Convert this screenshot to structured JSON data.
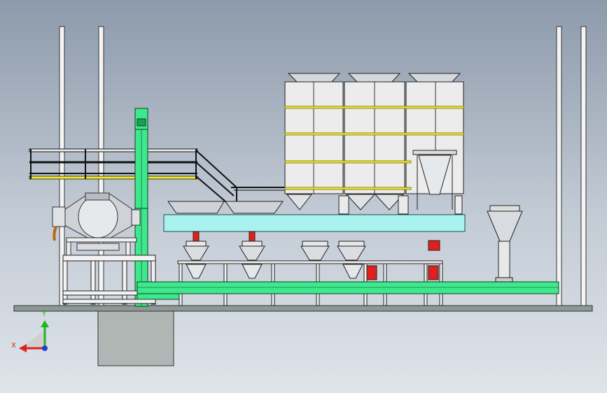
{
  "viewport": {
    "background_top": "#8c9aab",
    "background_bottom": "#dfe4ea"
  },
  "colors": {
    "green": "#3ee88c",
    "cyan": "#a9f2f0",
    "yellow": "#f5ee2a",
    "red": "#e02020",
    "steel": "#cfd3d8",
    "panel": "#ececec",
    "outline": "#1a1a1a",
    "floor": "#8d9a94",
    "pit": "#b0b6b4"
  },
  "triad": {
    "x_label": "X",
    "y_label": "Y",
    "x_color": "#e02020",
    "y_color": "#1fb51f",
    "z_color": "#1f3fd0"
  }
}
